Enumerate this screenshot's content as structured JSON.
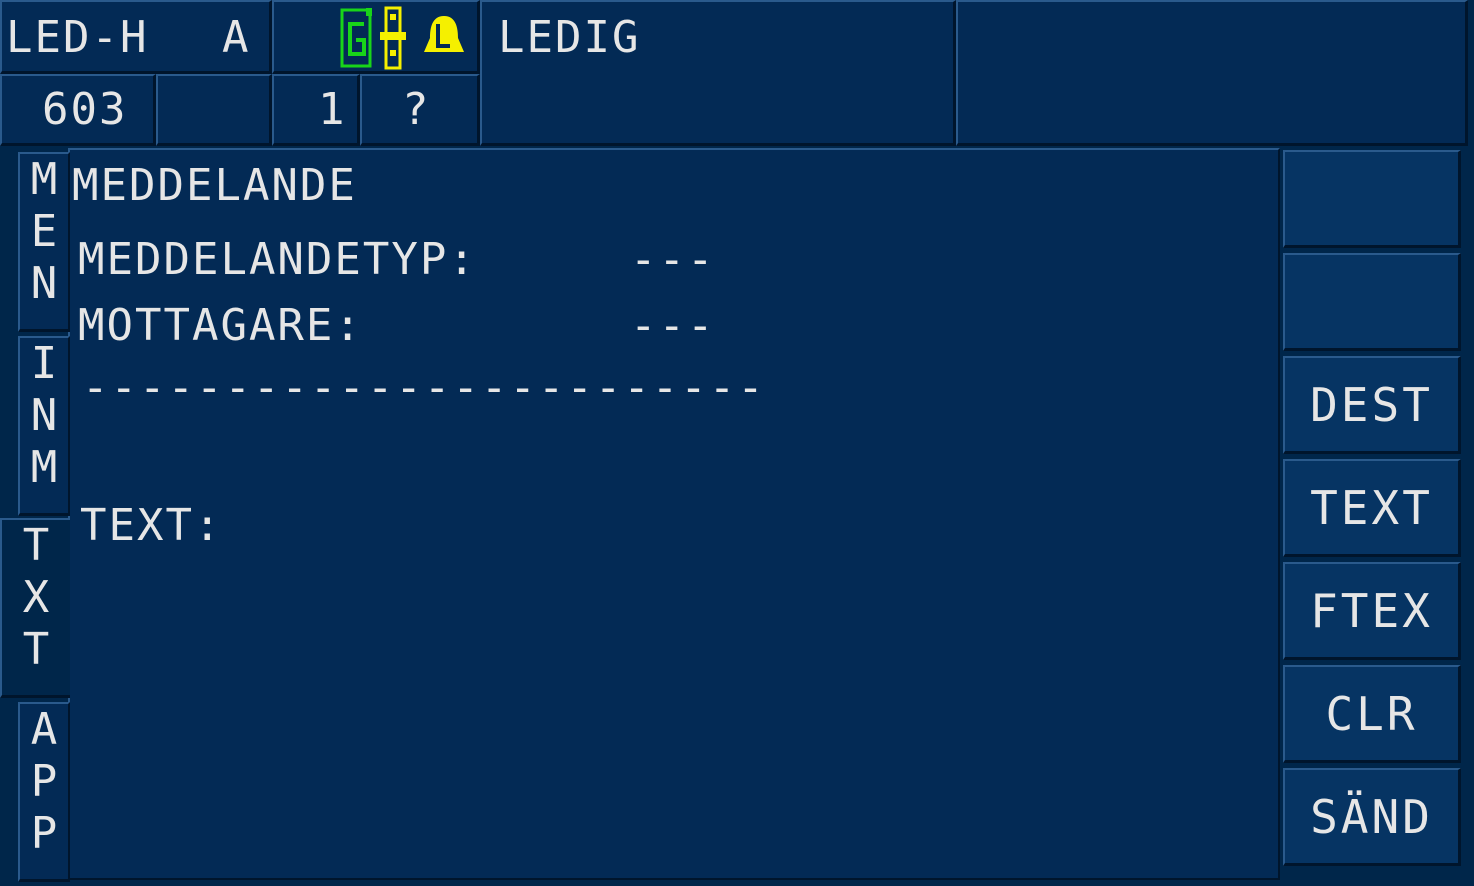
{
  "header": {
    "unit_label": "LED-H",
    "unit_suffix": "A",
    "status_text": "LEDIG",
    "number": "603",
    "count": "1",
    "query": "?"
  },
  "icons": {
    "icon_1": "signal-g-icon",
    "icon_2": "signal-bar-icon",
    "icon_3": "bell-alarm-icon",
    "color_green": "#19d419",
    "color_yellow": "#f5f000"
  },
  "side_tabs": [
    {
      "label": [
        "M",
        "E",
        "N"
      ]
    },
    {
      "label": [
        "I",
        "N",
        "M"
      ]
    },
    {
      "label": [
        "T",
        "X",
        "T"
      ]
    },
    {
      "label": [
        "A",
        "P",
        "P"
      ]
    }
  ],
  "content": {
    "title": "MEDDELANDE",
    "type_label": "MEDDELANDETYP:",
    "type_value": "---",
    "recipient_label": "MOTTAGARE:",
    "recipient_value": "---",
    "divider": "------------------------",
    "text_label": "TEXT:"
  },
  "softkeys": [
    "",
    "",
    "DEST",
    "TEXT",
    "FTEX",
    "CLR",
    "SÄND"
  ]
}
